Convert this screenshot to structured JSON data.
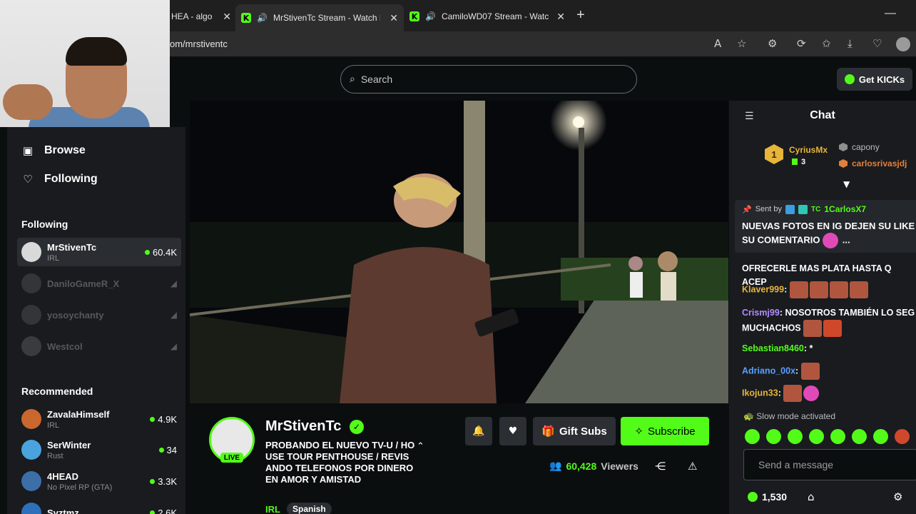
{
  "browser": {
    "tabs": [
      {
        "title": "HEA - algo"
      },
      {
        "title": "MrStivenTc Stream - Watch L"
      },
      {
        "title": "CamiloWD07 Stream - Watch"
      }
    ],
    "url": "om/mrstiventc"
  },
  "header": {
    "search_placeholder": "Search",
    "get_kicks": "Get KICKs"
  },
  "sidebar": {
    "nav": [
      {
        "label": "Browse",
        "icon": "browse-icon"
      },
      {
        "label": "Following",
        "icon": "heart-icon"
      }
    ],
    "following_heading": "Following",
    "following": [
      {
        "name": "MrStivenTc",
        "category": "IRL",
        "viewers": "60.4K",
        "live": true
      },
      {
        "name": "DaniloGameR_X",
        "live": false
      },
      {
        "name": "yosoychanty",
        "live": false
      },
      {
        "name": "Westcol",
        "live": false
      }
    ],
    "recommended_heading": "Recommended",
    "recommended": [
      {
        "name": "ZavalaHimself",
        "category": "IRL",
        "viewers": "4.9K"
      },
      {
        "name": "SerWinter",
        "category": "Rust",
        "viewers": "34"
      },
      {
        "name": "4HEAD",
        "category": "No Pixel RP (GTA)",
        "viewers": "3.3K"
      },
      {
        "name": "Syztmz",
        "category": "",
        "viewers": "2.6K"
      }
    ]
  },
  "stream": {
    "streamer": "MrStivenTc",
    "live_badge": "LIVE",
    "title": "PROBANDO EL NUEVO TV-U / HOUSE TOUR PENTHOUSE / REVISANDO TELEFONOS POR DINERO EN AMOR Y AMISTAD",
    "category": "IRL",
    "language": "Spanish",
    "viewers": "60,428",
    "viewers_label": "Viewers",
    "gift_subs": "Gift Subs",
    "subscribe": "Subscribe"
  },
  "chat": {
    "title": "Chat",
    "top_gifters": [
      {
        "rank": "1",
        "name": "CyriusMx",
        "count": "3"
      },
      {
        "name": "capony"
      },
      {
        "name": "carlosrivasjdj"
      }
    ],
    "pinned": {
      "sent_by": "Sent by",
      "tc": "TC",
      "user": "1CarlosX7",
      "message": "NUEVAS FOTOS EN IG DEJEN SU LIKE SU COMENTARIO",
      "ellipsis": "..."
    },
    "messages": [
      {
        "user": "",
        "text": "OFRECERLE MAS PLATA HASTA Q ACEP",
        "color": "#ffffff"
      },
      {
        "user": "Klaver999",
        "text": "",
        "color": "#e8b43a"
      },
      {
        "user": "Crismj99",
        "text": "NOSOTROS TAMBIÉN LO SEG MUCHACHOS",
        "color": "#b38cff"
      },
      {
        "user": "Sebastian8460",
        "text": "*",
        "color": "#53fc18"
      },
      {
        "user": "Adriano_00x",
        "text": "",
        "color": "#5aa0ff"
      },
      {
        "user": "Ikojun33",
        "text": "",
        "color": "#e8b43a"
      }
    ],
    "slow_mode": "Slow mode activated",
    "send_placeholder": "Send a message",
    "points": "1,530"
  }
}
